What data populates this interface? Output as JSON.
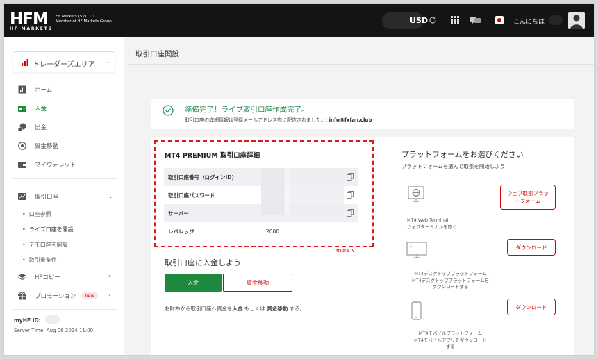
{
  "header": {
    "logo_text": "HFM",
    "logo_tagline": "HF MARKETS",
    "logo_line1": "HF Markets (SV) LTD",
    "logo_line2": "Member of HF Markets Group",
    "currency": "USD",
    "greeting": "こんにちは",
    "icons": [
      "refresh-icon",
      "apps-grid-icon",
      "chat-icon",
      "japan-flag-icon",
      "avatar"
    ]
  },
  "sidebar": {
    "area_select": "トレーダーズエリア",
    "items": [
      {
        "label": "ホーム",
        "icon": "dashboard-icon"
      },
      {
        "label": "入金",
        "icon": "deposit-icon"
      },
      {
        "label": "出金",
        "icon": "withdraw-icon"
      },
      {
        "label": "資金移動",
        "icon": "transfer-icon"
      },
      {
        "label": "マイウォレット",
        "icon": "wallet-icon"
      }
    ],
    "accounts": {
      "label": "取引口座",
      "subitems": [
        "口座参照",
        "ライブ口座を開設",
        "デモ口座を開設",
        "取引量条件"
      ]
    },
    "hfcopy": "HFコピー",
    "promotion": "プロモーション",
    "promotion_badge": "new",
    "myhf_label": "myHF ID:",
    "server_time": "Server Time: Aug 06 2024 11:00"
  },
  "main": {
    "page_title": "取引口座開設",
    "success_title": "準備完了！ライブ取引口座作成完了。",
    "success_sub": "取引口座の詳細情報は登録メールアドレス宛に配信されました。:",
    "success_email": "info@fxfan.club",
    "details_title": "MT4 PREMIUM 取引口座詳細",
    "details": [
      {
        "key": "取引口座番号（ログインID)",
        "value": ""
      },
      {
        "key": "取引口座パスワード",
        "value": ""
      },
      {
        "key": "サーバー",
        "value": ""
      },
      {
        "key": "レバレッジ",
        "value": "2000"
      }
    ],
    "more": "more",
    "deposit_title": "取引口座に入金しよう",
    "deposit_button": "入金",
    "transfer_button": "資金移動",
    "deposit_note_1": "お財布から取引口座へ資金を",
    "deposit_note_b1": "入金",
    "deposit_note_2": "もしくは",
    "deposit_note_b2": "資金移動",
    "deposit_note_3": "する。",
    "platform_title": "プラットフォームをお選びください",
    "platform_sub": "プラットフォームを選んで取引を開始しよう",
    "platforms": [
      {
        "icon": "globe-icon",
        "button": "ウェブ取引プラットフォーム",
        "desc1": "MT4 Web Terminal",
        "desc2": "ウェブターミナルを開く",
        "desc3": ""
      },
      {
        "icon": "desktop-icon",
        "button": "ダウンロード",
        "desc1": "MT4デスクトッププラットフォーム",
        "desc2": "MT4デスクトッププラットフォームを",
        "desc3": "ダウンロードする"
      },
      {
        "icon": "mobile-icon",
        "button": "ダウンロード",
        "desc1": "MT4モバイルプラットフォーム",
        "desc2": "MT4モバイルアプリをダウンロード",
        "desc3": "する"
      }
    ]
  },
  "colors": {
    "brand_red": "#d40000",
    "green": "#1e8a3e",
    "header_bg": "#141414",
    "highlight_dash": "#e01818"
  }
}
